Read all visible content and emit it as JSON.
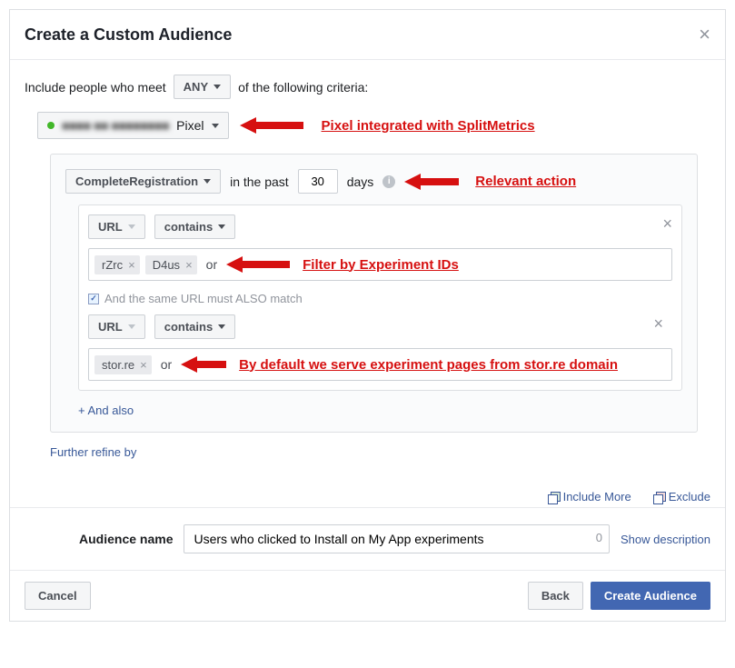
{
  "header": {
    "title": "Create a Custom Audience"
  },
  "criteria": {
    "prefix": "Include people who meet",
    "mode": "ANY",
    "suffix": "of the following criteria:"
  },
  "pixel": {
    "blurred_name": "■■■■ ■■ ■■■■■■■■",
    "label_suffix": "Pixel",
    "annotation": "Pixel integrated with SplitMetrics"
  },
  "event": {
    "action": "CompleteRegistration",
    "prefix": "in the past",
    "days": "30",
    "suffix": "days",
    "annotation": "Relevant action"
  },
  "filter1": {
    "field": "URL",
    "op": "contains",
    "chips": [
      "rZrc",
      "D4us"
    ],
    "or": "or",
    "annotation": "Filter by Experiment IDs"
  },
  "also_match": {
    "text": "And the same URL must ALSO match"
  },
  "filter2": {
    "field": "URL",
    "op": "contains",
    "chips": [
      "stor.re"
    ],
    "or": "or",
    "annotation": "By default we serve experiment pages from stor.re domain"
  },
  "and_also": "+ And also",
  "refine": "Further refine by",
  "footer_links": {
    "include": "Include More",
    "exclude": "Exclude"
  },
  "name": {
    "label": "Audience name",
    "value": "Users who clicked to Install on My App experiments",
    "count": "0",
    "show_desc": "Show description"
  },
  "buttons": {
    "cancel": "Cancel",
    "back": "Back",
    "create": "Create Audience"
  }
}
